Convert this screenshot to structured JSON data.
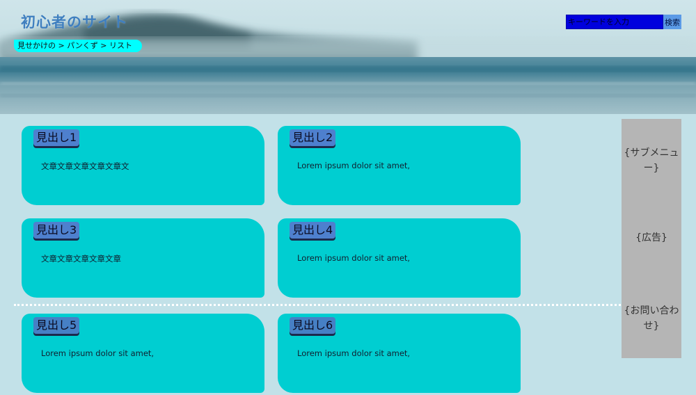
{
  "header": {
    "site_title": "初心者のサイト",
    "breadcrumb": "見せかけの > パンくず > リスト",
    "search": {
      "placeholder": "キーワードを入力",
      "button_label": "検索"
    }
  },
  "cards": [
    {
      "heading": "見出し1",
      "text": "文章文章文章文章文章文"
    },
    {
      "heading": "見出し2",
      "text": "Lorem ipsum dolor sit amet,"
    },
    {
      "heading": "見出し3",
      "text": "文章文章文章文章文章"
    },
    {
      "heading": "見出し4",
      "text": "Lorem ipsum dolor sit amet,"
    },
    {
      "heading": "見出し5",
      "text": "Lorem ipsum dolor sit amet,"
    },
    {
      "heading": "見出し6",
      "text": "Lorem ipsum dolor sit amet,"
    }
  ],
  "sidebar": {
    "items": [
      "{サブメニュー}",
      "{広告}",
      "{お問い合わせ}"
    ]
  },
  "colors": {
    "page_bg": "#c2e1e8",
    "card_bg": "#00ced1",
    "heading_bg": "#4e80ce",
    "breadcrumb_bg": "#00ffff",
    "search_input_bg": "#0000dd",
    "search_button_bg": "#5b9ae6",
    "sidebar_bg": "#b5b5b5",
    "title_color": "#3f7fbf"
  }
}
